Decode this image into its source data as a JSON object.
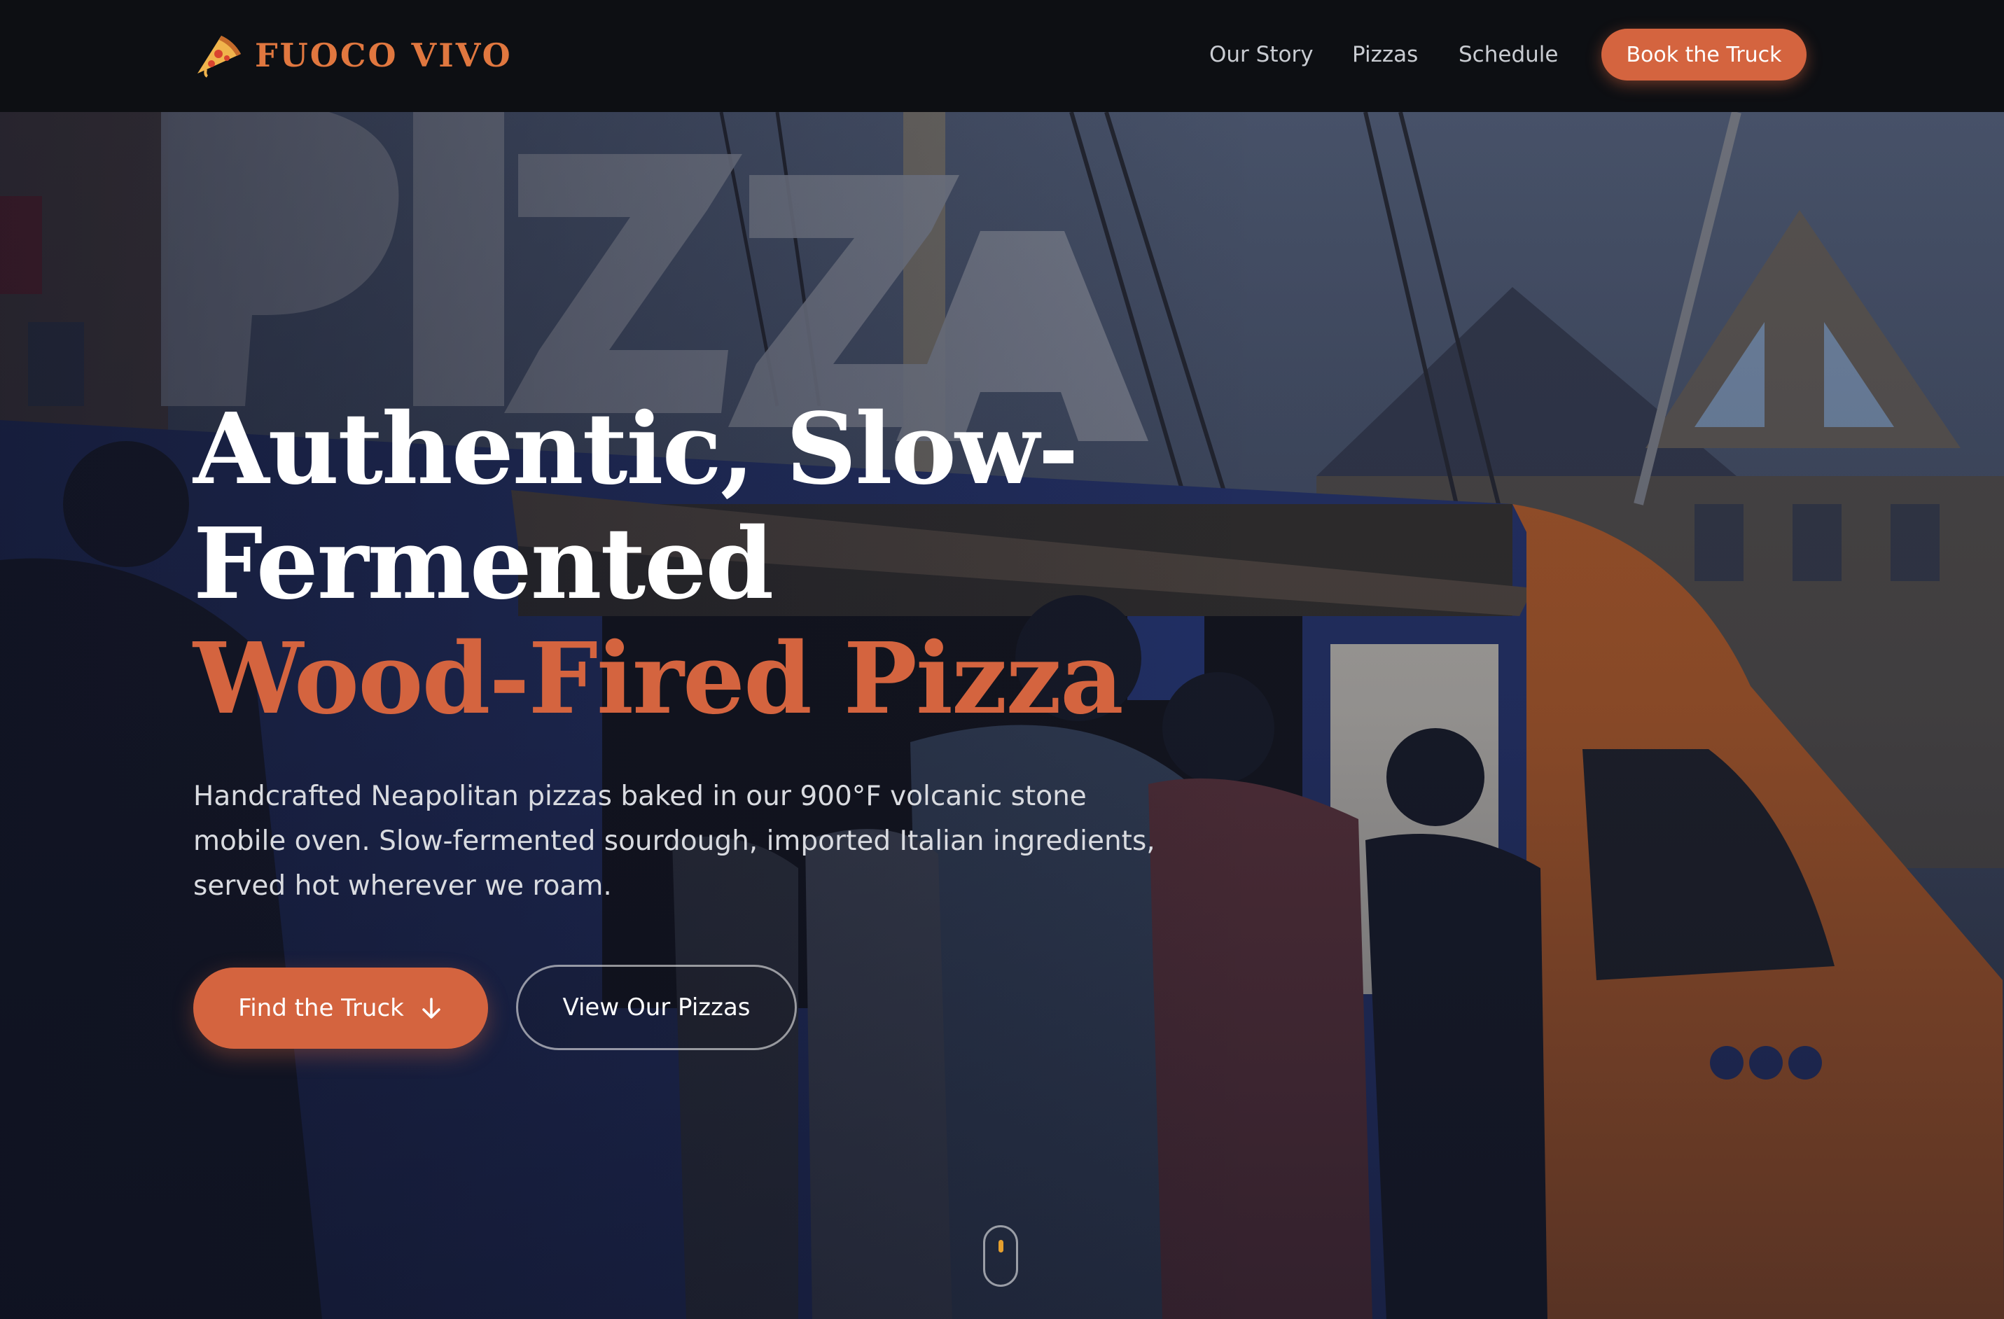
{
  "brand": {
    "name": "FUOCO VIVO",
    "icon": "pizza-slice-icon",
    "color": "#e0773f"
  },
  "nav": {
    "links": [
      {
        "label": "Our Story"
      },
      {
        "label": "Pizzas"
      },
      {
        "label": "Schedule"
      }
    ],
    "cta_label": "Book the Truck"
  },
  "hero": {
    "title_line1": "Authentic, Slow-",
    "title_line2": "Fermented",
    "title_accent": "Wood-Fired Pizza",
    "subtitle": "Handcrafted Neapolitan pizzas baked in our 900°F volcanic stone mobile oven. Slow-fermented sourdough, imported Italian ingredients, served hot wherever we roam.",
    "primary_button": "Find the Truck",
    "primary_button_icon": "arrow-down-icon",
    "secondary_button": "View Our Pizzas"
  },
  "scroll_indicator": {
    "icon": "mouse-scroll-icon"
  },
  "colors": {
    "accent": "#d4643f",
    "nav_background": "#0d0f13",
    "title_text": "#ffffff",
    "body_text": "#d9dbe0",
    "scroll_dot": "#e6a02e"
  }
}
